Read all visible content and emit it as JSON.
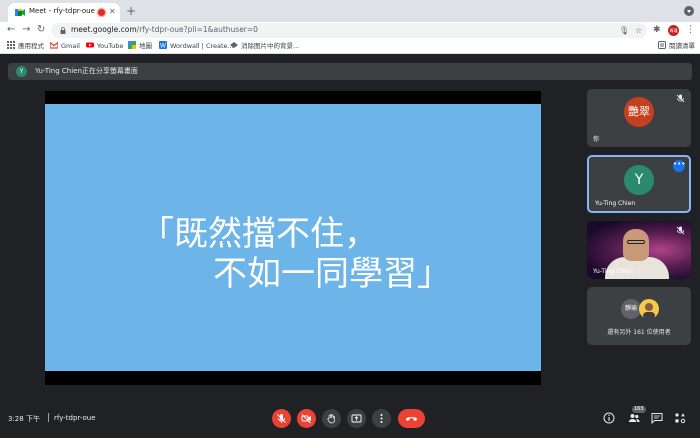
{
  "browser": {
    "tab_title": "Meet - rfy-tdpr-oue",
    "url_host": "meet.google.com",
    "url_path": "/rfy-tdpr-oue?pli=1&authuser=0",
    "profile_initials": "周瑾",
    "bookmarks": [
      {
        "label": "應用程式",
        "icon": "apps-grid-icon"
      },
      {
        "label": "Gmail",
        "icon": "gmail-icon"
      },
      {
        "label": "YouTube",
        "icon": "youtube-icon"
      },
      {
        "label": "地圖",
        "icon": "maps-icon"
      },
      {
        "label": "Wordwall | Create...",
        "icon": "wordwall-icon"
      },
      {
        "label": "消除图片中的背景...",
        "icon": "removebg-icon"
      }
    ],
    "reading_list": "閱讀清單"
  },
  "meet": {
    "share_banner": {
      "avatar_initial": "Y",
      "text": "Yu-Ting Chien正在分享螢幕畫面"
    },
    "slide": {
      "line1": "「既然擋不住，",
      "line2": "不如一同學習」",
      "bg_color": "#6db4e8"
    },
    "participants": [
      {
        "avatar_text": "艷翠",
        "name": "你",
        "avatar_color": "#c5401f",
        "muted": true
      },
      {
        "avatar_text": "Y",
        "name": "Yu-Ting Chien",
        "avatar_color": "#2b8a6e",
        "active": true
      },
      {
        "avatar_text": "",
        "name": "Yu-Ting Chien",
        "muted": true,
        "video": true
      },
      {
        "avatar_text": "靜瑜",
        "name": "還有另外 161 位使用者"
      }
    ],
    "bottom": {
      "time": "3:28 下午",
      "meeting_code": "rfy-tdpr-oue",
      "people_count": "163"
    }
  },
  "colors": {
    "accent": "#8ab4f8",
    "danger": "#ea4335",
    "surface": "#3c4043",
    "background": "#202124"
  }
}
